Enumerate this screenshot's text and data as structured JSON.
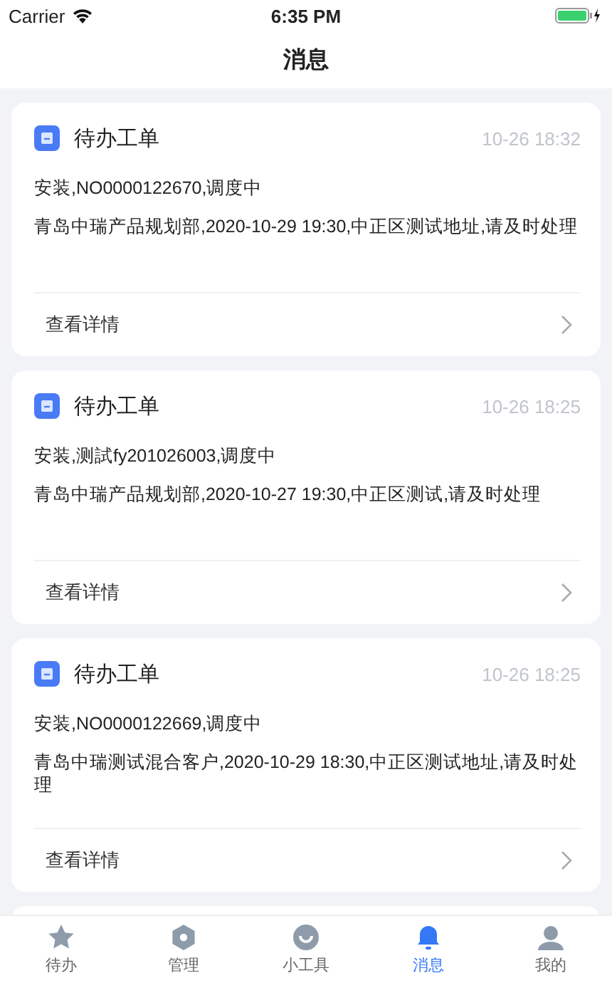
{
  "status_bar": {
    "carrier": "Carrier",
    "time": "6:35 PM"
  },
  "nav": {
    "title": "消息"
  },
  "messages": [
    {
      "title": "待办工单",
      "time": "10-26 18:32",
      "summary": "安装,NO0000122670,调度中",
      "detail": "青岛中瑞产品规划部,2020-10-29 19:30,中正区测试地址,请及时处理",
      "action": "查看详情"
    },
    {
      "title": "待办工单",
      "time": "10-26 18:25",
      "summary": "安装,测試fy201026003,调度中",
      "detail": "青岛中瑞产品规划部,2020-10-27 19:30,中正区测试,请及时处理",
      "action": "查看详情"
    },
    {
      "title": "待办工单",
      "time": "10-26 18:25",
      "summary": "安装,NO0000122669,调度中",
      "detail": "青岛中瑞测试混合客户,2020-10-29 18:30,中正区测试地址,请及时处理",
      "action": "查看详情"
    }
  ],
  "tabs": [
    {
      "kind": "star",
      "label": "待办",
      "selected": false
    },
    {
      "kind": "gear",
      "label": "管理",
      "selected": false
    },
    {
      "kind": "smile",
      "label": "小工具",
      "selected": false
    },
    {
      "kind": "bell",
      "label": "消息",
      "selected": true
    },
    {
      "kind": "person",
      "label": "我的",
      "selected": false
    }
  ]
}
